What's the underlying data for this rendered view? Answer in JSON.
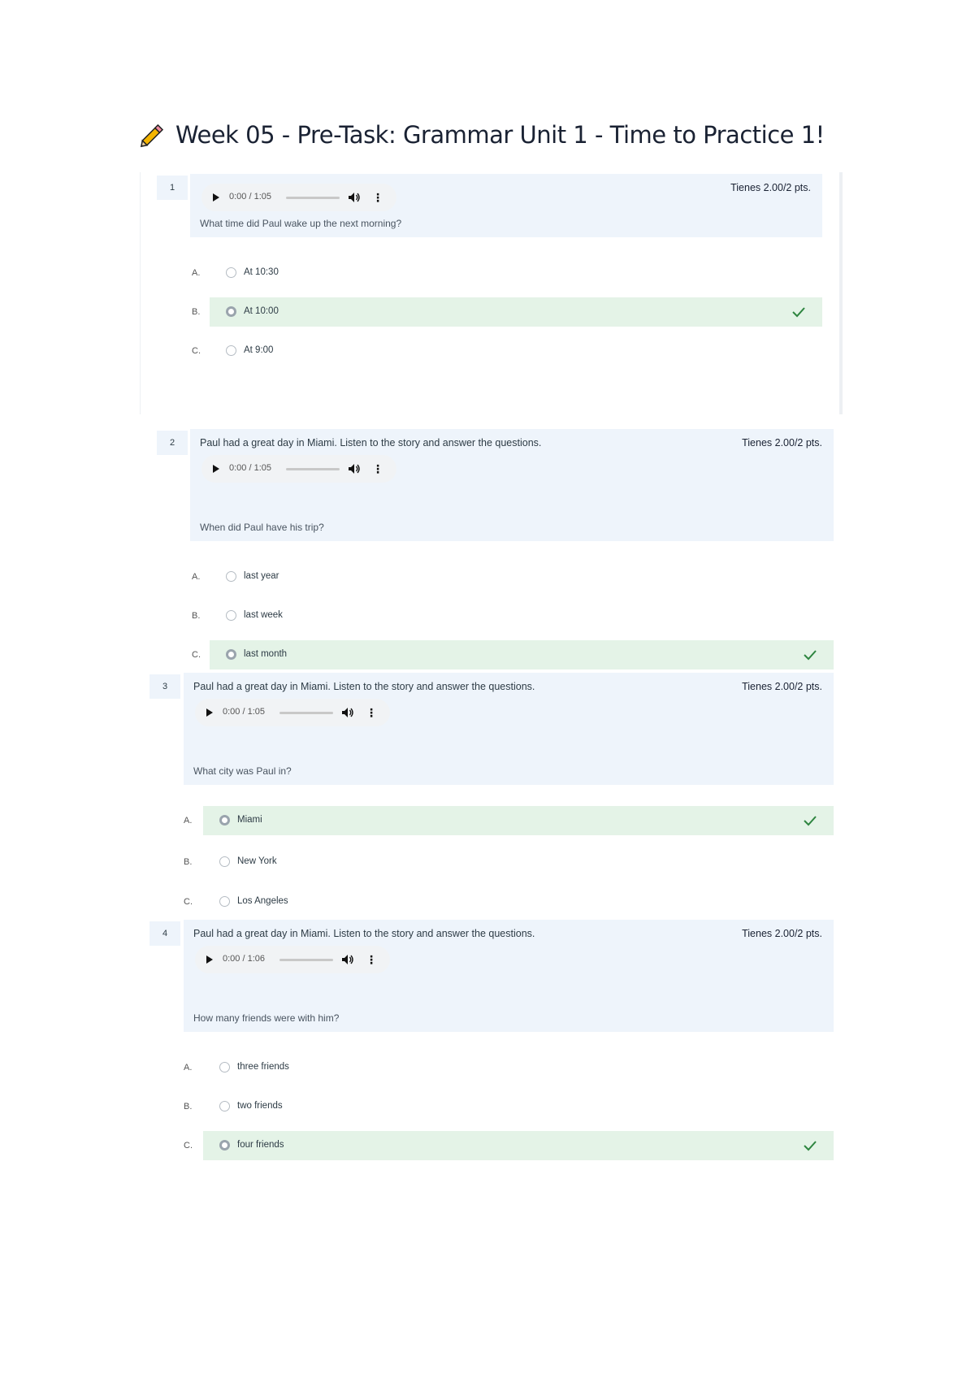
{
  "page": {
    "title": "Week 05 - Pre-Task: Grammar Unit 1 - Time to Practice 1!"
  },
  "icons": {
    "title_icon": "pencil-icon",
    "correct_icon": "checkmark-icon",
    "audio_play": "play-icon",
    "audio_volume": "volume-icon",
    "audio_menu": "more-vertical-icon"
  },
  "colors": {
    "question_header_bg": "#eef4fb",
    "correct_bg": "#e4f3e7",
    "check": "#2e8540"
  },
  "questions": [
    {
      "number": "1",
      "points": "Tienes 2.00/2 pts.",
      "intro": "",
      "audio": {
        "time": "0:00 / 1:05"
      },
      "prompt": "What time did Paul wake up the next morning?",
      "options": [
        {
          "letter": "A.",
          "text": "At 10:30",
          "correct": false
        },
        {
          "letter": "B.",
          "text": "At 10:00",
          "correct": true
        },
        {
          "letter": "C.",
          "text": "At 9:00",
          "correct": false
        }
      ]
    },
    {
      "number": "2",
      "points": "Tienes 2.00/2 pts.",
      "intro": "Paul had a great day in Miami. Listen to the story and answer the questions.",
      "audio": {
        "time": "0:00 / 1:05"
      },
      "prompt": "When did Paul have his trip?",
      "options": [
        {
          "letter": "A.",
          "text": "last year",
          "correct": false
        },
        {
          "letter": "B.",
          "text": "last week",
          "correct": false
        },
        {
          "letter": "C.",
          "text": "last month",
          "correct": true
        }
      ]
    },
    {
      "number": "3",
      "points": "Tienes 2.00/2 pts.",
      "intro": "Paul had a great day in Miami. Listen to the story and answer the questions.",
      "audio": {
        "time": "0:00 / 1:05"
      },
      "prompt": "What city was Paul in?",
      "options": [
        {
          "letter": "A.",
          "text": "Miami",
          "correct": true
        },
        {
          "letter": "B.",
          "text": "New York",
          "correct": false
        },
        {
          "letter": "C.",
          "text": "Los Angeles",
          "correct": false
        }
      ]
    },
    {
      "number": "4",
      "points": "Tienes 2.00/2 pts.",
      "intro": "Paul had a great day in Miami. Listen to the story and answer the questions.",
      "audio": {
        "time": "0:00 / 1:06"
      },
      "prompt": "How many friends were with him?",
      "options": [
        {
          "letter": "A.",
          "text": "three friends",
          "correct": false
        },
        {
          "letter": "B.",
          "text": "two friends",
          "correct": false
        },
        {
          "letter": "C.",
          "text": "four friends",
          "correct": true
        }
      ]
    }
  ]
}
